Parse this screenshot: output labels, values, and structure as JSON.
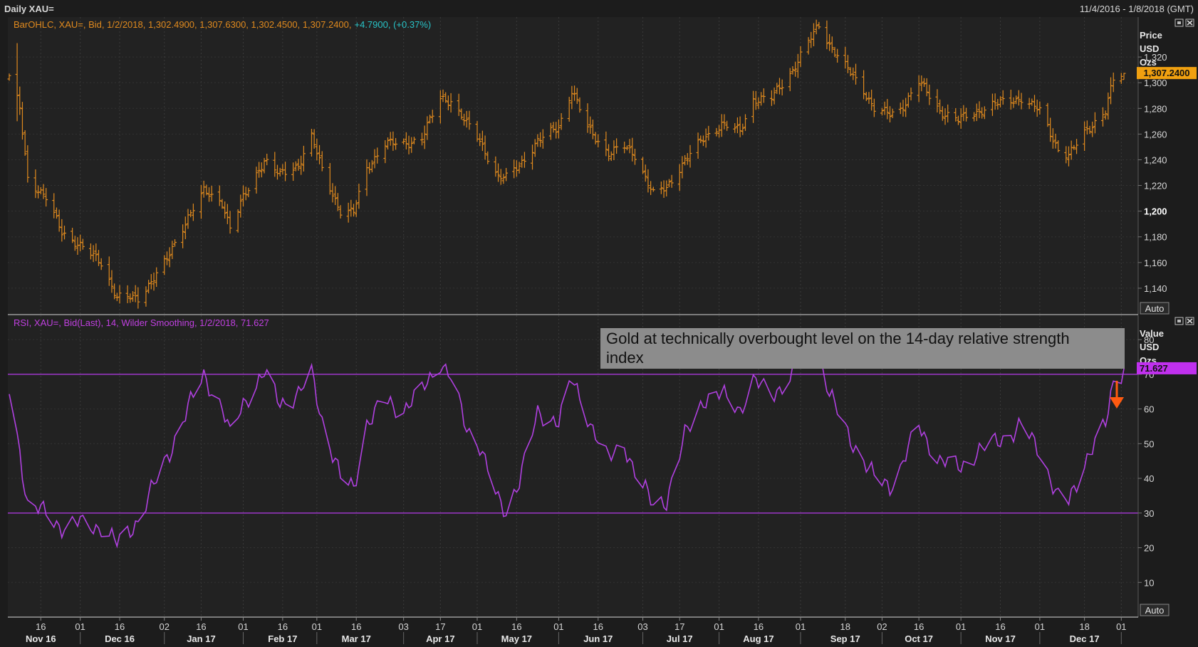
{
  "header": {
    "title": "Daily XAU=",
    "date_range": "11/4/2016 - 1/8/2018 (GMT)"
  },
  "colors": {
    "background": "#1c1c1c",
    "grid": "#333333",
    "ohlc": "#e08a1e",
    "rsi": "#b040e0",
    "change": "#28c4c8",
    "last_price_box": "#f0a010",
    "arrow": "#ff5a10",
    "annotation_box": "#8c8c8c"
  },
  "price_panel": {
    "legend_main": "BarOHLC, XAU=, Bid, 1/2/2018, 1,302.4900, 1,307.6300, 1,302.4500, 1,307.2400,",
    "legend_change": "+4.7900, (+0.37%)",
    "unit_lines": [
      "Price",
      "USD",
      "Ozs"
    ],
    "last_value_label": "1,307.2400",
    "auto_label": "Auto"
  },
  "rsi_panel": {
    "legend": "RSI, XAU=, Bid(Last),  14, Wilder Smoothing, 1/2/2018, 71.627",
    "unit_lines": [
      "Value",
      "USD",
      "Ozs"
    ],
    "last_value_label": "71.627",
    "auto_label": "Auto",
    "annotation": "Gold at technically overbought level on the 14-day relative strength index"
  },
  "x_axis": {
    "day_ticks": [
      "16",
      "01",
      "16",
      "02",
      "16",
      "01",
      "16",
      "01",
      "16",
      "03",
      "17",
      "01",
      "16",
      "01",
      "16",
      "03",
      "17",
      "01",
      "16",
      "01",
      "18",
      "02",
      "16",
      "01",
      "16",
      "01",
      "18",
      "01"
    ],
    "month_labels": [
      "Nov 16",
      "Dec 16",
      "Jan 17",
      "Feb 17",
      "Mar 17",
      "Apr 17",
      "May 17",
      "Jun 17",
      "Jul 17",
      "Aug 17",
      "Sep 17",
      "Oct 17",
      "Nov 17",
      "Dec 17"
    ]
  },
  "chart_data": [
    {
      "type": "ohlc",
      "ylim": [
        1125,
        1340
      ],
      "y_ticks": [
        "1,140",
        "1,160",
        "1,180",
        "1,200",
        "1,220",
        "1,240",
        "1,260",
        "1,280",
        "1,300",
        "1,320"
      ],
      "y_tick_values": [
        1140,
        1160,
        1180,
        1200,
        1220,
        1240,
        1260,
        1280,
        1300,
        1320
      ],
      "last": {
        "date": "1/2/2018",
        "open": 1302.49,
        "high": 1307.63,
        "low": 1302.45,
        "close": 1307.24,
        "change": 4.79,
        "change_pct": 0.37
      },
      "close_keypoints": [
        [
          "2016-11-04",
          1304
        ],
        [
          "2016-11-08",
          1280
        ],
        [
          "2016-11-11",
          1226
        ],
        [
          "2016-11-18",
          1210
        ],
        [
          "2016-11-24",
          1184
        ],
        [
          "2016-12-01",
          1173
        ],
        [
          "2016-12-09",
          1160
        ],
        [
          "2016-12-15",
          1133
        ],
        [
          "2016-12-23",
          1132
        ],
        [
          "2017-01-03",
          1162
        ],
        [
          "2017-01-11",
          1196
        ],
        [
          "2017-01-17",
          1215
        ],
        [
          "2017-01-24",
          1207
        ],
        [
          "2017-01-27",
          1187
        ],
        [
          "2017-02-01",
          1210
        ],
        [
          "2017-02-09",
          1240
        ],
        [
          "2017-02-15",
          1228
        ],
        [
          "2017-02-22",
          1236
        ],
        [
          "2017-02-27",
          1258
        ],
        [
          "2017-03-03",
          1232
        ],
        [
          "2017-03-10",
          1200
        ],
        [
          "2017-03-15",
          1199
        ],
        [
          "2017-03-20",
          1233
        ],
        [
          "2017-03-27",
          1253
        ],
        [
          "2017-04-03",
          1252
        ],
        [
          "2017-04-10",
          1257
        ],
        [
          "2017-04-17",
          1288
        ],
        [
          "2017-04-21",
          1286
        ],
        [
          "2017-04-27",
          1268
        ],
        [
          "2017-05-02",
          1255
        ],
        [
          "2017-05-09",
          1226
        ],
        [
          "2017-05-12",
          1226
        ],
        [
          "2017-05-17",
          1236
        ],
        [
          "2017-05-24",
          1254
        ],
        [
          "2017-06-01",
          1266
        ],
        [
          "2017-06-06",
          1294
        ],
        [
          "2017-06-12",
          1265
        ],
        [
          "2017-06-20",
          1245
        ],
        [
          "2017-06-26",
          1250
        ],
        [
          "2017-06-30",
          1244
        ],
        [
          "2017-07-07",
          1213
        ],
        [
          "2017-07-12",
          1218
        ],
        [
          "2017-07-19",
          1240
        ],
        [
          "2017-07-26",
          1256
        ],
        [
          "2017-08-02",
          1268
        ],
        [
          "2017-08-09",
          1262
        ],
        [
          "2017-08-14",
          1287
        ],
        [
          "2017-08-21",
          1288
        ],
        [
          "2017-08-29",
          1310
        ],
        [
          "2017-09-01",
          1321
        ],
        [
          "2017-09-08",
          1345
        ],
        [
          "2017-09-12",
          1330
        ],
        [
          "2017-09-19",
          1310
        ],
        [
          "2017-09-25",
          1294
        ],
        [
          "2017-09-29",
          1280
        ],
        [
          "2017-10-05",
          1275
        ],
        [
          "2017-10-09",
          1279
        ],
        [
          "2017-10-16",
          1301
        ],
        [
          "2017-10-24",
          1278
        ],
        [
          "2017-10-31",
          1271
        ],
        [
          "2017-11-06",
          1276
        ],
        [
          "2017-11-13",
          1283
        ],
        [
          "2017-11-20",
          1286
        ],
        [
          "2017-11-24",
          1288
        ],
        [
          "2017-12-01",
          1278
        ],
        [
          "2017-12-08",
          1248
        ],
        [
          "2017-12-12",
          1243
        ],
        [
          "2017-12-18",
          1261
        ],
        [
          "2017-12-26",
          1278
        ],
        [
          "2017-12-29",
          1302
        ],
        [
          "2018-01-02",
          1307
        ]
      ]
    },
    {
      "type": "line",
      "name": "RSI",
      "ylim": [
        0,
        87
      ],
      "y_ticks": [
        "10",
        "20",
        "30",
        "40",
        "50",
        "60",
        "70",
        "80"
      ],
      "y_tick_values": [
        10,
        20,
        30,
        40,
        50,
        60,
        70,
        80
      ],
      "reference_lines": [
        30,
        70
      ],
      "last_value": 71.627,
      "series_keypoints": [
        [
          "2016-11-04",
          66
        ],
        [
          "2016-11-08",
          48
        ],
        [
          "2016-11-11",
          32
        ],
        [
          "2016-11-18",
          30
        ],
        [
          "2016-11-24",
          26
        ],
        [
          "2016-12-01",
          27
        ],
        [
          "2016-12-09",
          26
        ],
        [
          "2016-12-15",
          21
        ],
        [
          "2016-12-23",
          28
        ],
        [
          "2017-01-03",
          46
        ],
        [
          "2017-01-11",
          60
        ],
        [
          "2017-01-17",
          70
        ],
        [
          "2017-01-24",
          60
        ],
        [
          "2017-01-27",
          52
        ],
        [
          "2017-02-01",
          62
        ],
        [
          "2017-02-09",
          70
        ],
        [
          "2017-02-15",
          62
        ],
        [
          "2017-02-22",
          64
        ],
        [
          "2017-02-27",
          70
        ],
        [
          "2017-03-03",
          57
        ],
        [
          "2017-03-10",
          40
        ],
        [
          "2017-03-15",
          37
        ],
        [
          "2017-03-20",
          56
        ],
        [
          "2017-03-27",
          62
        ],
        [
          "2017-04-03",
          60
        ],
        [
          "2017-04-10",
          65
        ],
        [
          "2017-04-17",
          74
        ],
        [
          "2017-04-21",
          69
        ],
        [
          "2017-04-27",
          54
        ],
        [
          "2017-05-02",
          50
        ],
        [
          "2017-05-09",
          33
        ],
        [
          "2017-05-12",
          30
        ],
        [
          "2017-05-17",
          40
        ],
        [
          "2017-05-24",
          58
        ],
        [
          "2017-06-01",
          57
        ],
        [
          "2017-06-06",
          68
        ],
        [
          "2017-06-12",
          58
        ],
        [
          "2017-06-20",
          45
        ],
        [
          "2017-06-26",
          50
        ],
        [
          "2017-06-30",
          42
        ],
        [
          "2017-07-07",
          32
        ],
        [
          "2017-07-12",
          34
        ],
        [
          "2017-07-19",
          52
        ],
        [
          "2017-07-26",
          63
        ],
        [
          "2017-08-02",
          64
        ],
        [
          "2017-08-09",
          60
        ],
        [
          "2017-08-14",
          68
        ],
        [
          "2017-08-21",
          64
        ],
        [
          "2017-08-29",
          70
        ],
        [
          "2017-09-01",
          75
        ],
        [
          "2017-09-08",
          78
        ],
        [
          "2017-09-12",
          64
        ],
        [
          "2017-09-19",
          53
        ],
        [
          "2017-09-25",
          45
        ],
        [
          "2017-09-29",
          40
        ],
        [
          "2017-10-05",
          38
        ],
        [
          "2017-10-09",
          43
        ],
        [
          "2017-10-16",
          55
        ],
        [
          "2017-10-24",
          45
        ],
        [
          "2017-10-31",
          43
        ],
        [
          "2017-11-06",
          47
        ],
        [
          "2017-11-13",
          50
        ],
        [
          "2017-11-20",
          53
        ],
        [
          "2017-11-24",
          55
        ],
        [
          "2017-12-01",
          48
        ],
        [
          "2017-12-08",
          34
        ],
        [
          "2017-12-12",
          33
        ],
        [
          "2017-12-18",
          45
        ],
        [
          "2017-12-26",
          55
        ],
        [
          "2017-12-29",
          68
        ],
        [
          "2018-01-02",
          71.627
        ]
      ]
    }
  ]
}
